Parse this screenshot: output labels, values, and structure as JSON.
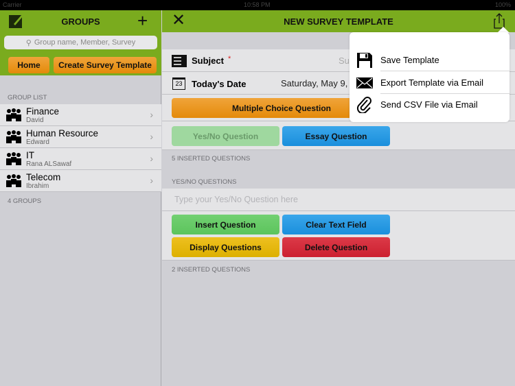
{
  "status": {
    "carrier": "Carrier",
    "time": "10:58 PM",
    "battery": "100%"
  },
  "left": {
    "title": "GROUPS",
    "search_placeholder": "Group name, Member, Survey",
    "home": "Home",
    "create": "Create Survey Template",
    "section": "GROUP LIST",
    "footer": "4 GROUPS",
    "groups": [
      {
        "name": "Finance",
        "member": "David"
      },
      {
        "name": "Human Resource",
        "member": "Edward"
      },
      {
        "name": "IT",
        "member": "Rana ALSawaf"
      },
      {
        "name": "Telecom",
        "member": "Ibrahim"
      }
    ]
  },
  "right": {
    "title": "NEW SURVEY TEMPLATE",
    "subject_label": "Subject",
    "required": "*",
    "subject_placeholder": "Su",
    "date_label": "Today's Date",
    "date_icon_num": "23",
    "date_value": "Saturday, May 9, 2",
    "mcq": "Multiple Choice Question",
    "yesno": "Yes/No Question",
    "essay": "Essay Question",
    "inserted1": "5 INSERTED QUESTIONS",
    "section2": "YES/NO QUESTIONS",
    "input_placeholder": "Type your Yes/No Question here",
    "insert": "Insert Question",
    "clear": "Clear Text Field",
    "display": "Display Questions",
    "delete": "Delete Question",
    "inserted2": "2 INSERTED QUESTIONS"
  },
  "menu": [
    {
      "label": "Save Template",
      "icon": "floppy-disk-icon"
    },
    {
      "label": "Export Template via Email",
      "icon": "envelope-icon"
    },
    {
      "label": "Send CSV File via Email",
      "icon": "paperclip-icon"
    }
  ],
  "colors": {
    "header_green": "#7aab1e",
    "orange": "#e48a0a",
    "green": "#5cc45c",
    "blue": "#1a8fdc",
    "yellow": "#ddb000",
    "red": "#cc2030"
  }
}
